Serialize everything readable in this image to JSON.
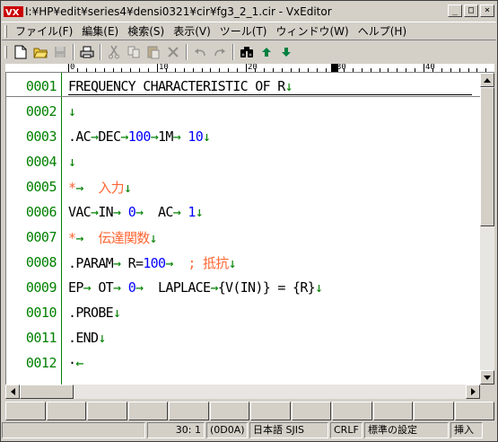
{
  "window": {
    "title": "I:¥HP¥edit¥series4¥densi0321¥cir¥fg3_2_1.cir - VxEditor",
    "app_logo_text": "VX"
  },
  "title_buttons": [
    "_",
    "□",
    "×"
  ],
  "menu": [
    {
      "label": "ファイル(F)"
    },
    {
      "label": "編集(E)"
    },
    {
      "label": "検索(S)"
    },
    {
      "label": "表示(V)"
    },
    {
      "label": "ツール(T)"
    },
    {
      "label": "ウィンドウ(W)"
    },
    {
      "label": "ヘルプ(H)"
    }
  ],
  "toolbar": [
    {
      "icon": "new-file-icon",
      "enabled": true
    },
    {
      "icon": "open-folder-icon",
      "enabled": true
    },
    {
      "icon": "save-icon",
      "enabled": false
    },
    {
      "icon": "print-icon",
      "enabled": true
    },
    {
      "icon": "cut-icon",
      "enabled": false
    },
    {
      "icon": "copy-icon",
      "enabled": false
    },
    {
      "icon": "paste-icon",
      "enabled": false
    },
    {
      "icon": "delete-icon",
      "enabled": false
    },
    {
      "icon": "undo-icon",
      "enabled": false
    },
    {
      "icon": "redo-icon",
      "enabled": false
    },
    {
      "icon": "find-icon",
      "enabled": true
    },
    {
      "icon": "find-prev-icon",
      "enabled": true
    },
    {
      "icon": "find-next-icon",
      "enabled": true
    }
  ],
  "ruler": {
    "labels": [
      "0",
      "10",
      "20",
      "30",
      "40"
    ]
  },
  "lines": [
    {
      "num": "0001",
      "segs": [
        {
          "t": "FREQUENCY CHARACTERISTIC OF R",
          "c": "black"
        },
        {
          "t": "↓",
          "c": "green"
        }
      ]
    },
    {
      "num": "0002",
      "segs": [
        {
          "t": "↓",
          "c": "green"
        }
      ]
    },
    {
      "num": "0003",
      "segs": [
        {
          "t": ".AC",
          "c": "black"
        },
        {
          "t": "→",
          "c": "green"
        },
        {
          "t": "DEC",
          "c": "black"
        },
        {
          "t": "→",
          "c": "green"
        },
        {
          "t": "100",
          "c": "blue"
        },
        {
          "t": "→",
          "c": "green"
        },
        {
          "t": "1M",
          "c": "black"
        },
        {
          "t": "→ ",
          "c": "green"
        },
        {
          "t": "10",
          "c": "blue"
        },
        {
          "t": "↓",
          "c": "green"
        }
      ]
    },
    {
      "num": "0004",
      "segs": [
        {
          "t": "↓",
          "c": "green"
        }
      ]
    },
    {
      "num": "0005",
      "segs": [
        {
          "t": "*",
          "c": "orange"
        },
        {
          "t": "→  ",
          "c": "green"
        },
        {
          "t": "入力",
          "c": "orange"
        },
        {
          "t": "↓",
          "c": "green"
        }
      ]
    },
    {
      "num": "0006",
      "segs": [
        {
          "t": "VAC",
          "c": "black"
        },
        {
          "t": "→",
          "c": "green"
        },
        {
          "t": "IN",
          "c": "black"
        },
        {
          "t": "→ ",
          "c": "green"
        },
        {
          "t": "0",
          "c": "blue"
        },
        {
          "t": "→  ",
          "c": "green"
        },
        {
          "t": "AC",
          "c": "black"
        },
        {
          "t": "→ ",
          "c": "green"
        },
        {
          "t": "1",
          "c": "blue"
        },
        {
          "t": "↓",
          "c": "green"
        }
      ]
    },
    {
      "num": "0007",
      "segs": [
        {
          "t": "*",
          "c": "orange"
        },
        {
          "t": "→  ",
          "c": "green"
        },
        {
          "t": "伝達関数",
          "c": "orange"
        },
        {
          "t": "↓",
          "c": "green"
        }
      ]
    },
    {
      "num": "0008",
      "segs": [
        {
          "t": ".PARAM",
          "c": "black"
        },
        {
          "t": "→ ",
          "c": "green"
        },
        {
          "t": "R=",
          "c": "black"
        },
        {
          "t": "100",
          "c": "blue"
        },
        {
          "t": "→  ",
          "c": "green"
        },
        {
          "t": "; 抵抗",
          "c": "orange"
        },
        {
          "t": "↓",
          "c": "green"
        }
      ]
    },
    {
      "num": "0009",
      "segs": [
        {
          "t": "EP",
          "c": "black"
        },
        {
          "t": "→ ",
          "c": "green"
        },
        {
          "t": "OT",
          "c": "black"
        },
        {
          "t": "→ ",
          "c": "green"
        },
        {
          "t": "0",
          "c": "blue"
        },
        {
          "t": "→  ",
          "c": "green"
        },
        {
          "t": "LAPLACE",
          "c": "black"
        },
        {
          "t": "→",
          "c": "green"
        },
        {
          "t": "{V(IN)} = {R}",
          "c": "black"
        },
        {
          "t": "↓",
          "c": "green"
        }
      ]
    },
    {
      "num": "0010",
      "segs": [
        {
          "t": ".PROBE",
          "c": "black"
        },
        {
          "t": "↓",
          "c": "green"
        }
      ]
    },
    {
      "num": "0011",
      "segs": [
        {
          "t": ".END",
          "c": "black"
        },
        {
          "t": "↓",
          "c": "green"
        }
      ]
    },
    {
      "num": "0012",
      "segs": [
        {
          "t": "·",
          "c": "black"
        },
        {
          "t": "←",
          "c": "green"
        }
      ]
    }
  ],
  "colors": {
    "black": "#000000",
    "green": "#008000",
    "blue": "#0000ff",
    "orange": "#ff6633"
  },
  "status": {
    "position": "30: 1",
    "char_code": "(0D0A)",
    "encoding": "日本語 SJIS",
    "line_end": "CRLF",
    "settings": "標準の設定",
    "mode": "挿入"
  }
}
